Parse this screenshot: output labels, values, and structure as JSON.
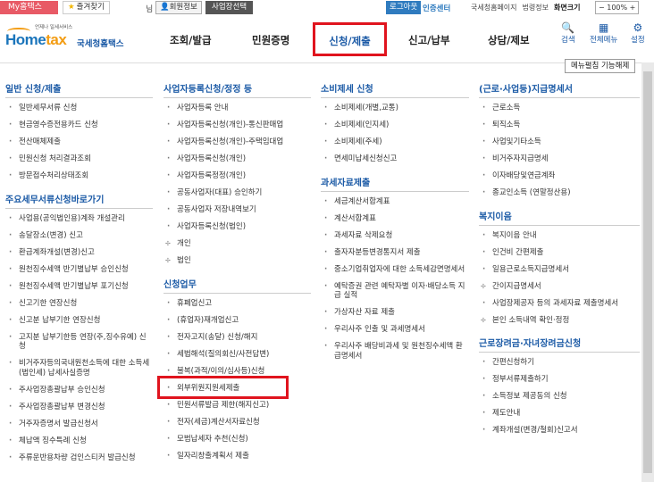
{
  "topbar": {
    "myhome": "My홈택스",
    "favorites": "즐겨찾기",
    "user_suffix": "님",
    "member_info": "회원정보",
    "biz_select": "사업장선택",
    "logout": "로그아웃",
    "cert_center": "인증센터",
    "links": [
      "국세청홈페이지",
      "법령정보"
    ],
    "screen_size": "화면크기",
    "zoom": "100%"
  },
  "logo": {
    "tagline": "언제나 일세서비스",
    "name_en_1": "Home",
    "name_en_2": "tax",
    "name_ko": "국세청홈택스"
  },
  "gnb": {
    "items": [
      "조회/발급",
      "민원증명",
      "신청/제출",
      "신고/납부",
      "상담/제보"
    ],
    "active": "신청/제출",
    "search": "검색",
    "all_menu": "전체메뉴",
    "settings": "설정"
  },
  "menu_fix": "메뉴펼침 기능해제",
  "col1": {
    "title": "일반 신청/제출",
    "items": [
      "일반세무서류 신청",
      "현금영수증전용카드 신청",
      "전산매체제출",
      "민원신청 처리결과조회",
      "방문접수처리상태조회"
    ],
    "title2": "주요세무서류신청바로가기",
    "items2": [
      "사업용(공익법인용)계좌 개설관리",
      "송달장소(변경) 신고",
      "환급계좌개설(변경)신고",
      "원천징수세액 반기별납부 승인신청",
      "원천징수세액 반기별납부 포기신청",
      "신고기한 연장신청",
      "신고분 납부기한 연장신청",
      "고지분 납부기한등 연장(주,징수유예) 신청",
      "비거주자등의국내원천소득에 대한 소득세(법인세) 납세사실증명",
      "주사업장총괄납부 승인신청",
      "주사업장총괄납부 변경신청",
      "거주자증명서 발급신청서",
      "체납액 징수특례 신청",
      "주류운반용차량 검인스티커 발급신청"
    ]
  },
  "col2": {
    "title": "사업자등록신청/정정 등",
    "items": [
      "사업자등록 안내",
      "사업자등록신청(개인)-통신판매업",
      "사업자등록신청(개인)-주택임대업",
      "사업자등록신청(개인)",
      "사업자등록정정(개인)",
      "공동사업자(대표) 승인하기",
      "공동사업자 저장내역보기",
      "사업자등록신청(법인)"
    ],
    "plus_items": [
      "개인",
      "법인"
    ],
    "title2": "신청업무",
    "items2": [
      "휴폐업신고",
      "(휴업자)재개업신고",
      "전자고지(송달) 신청/해지",
      "세법해석(질의회신/사전답변)",
      "불복(과적/이의/심사등)신청",
      "외부위원지원세제출",
      "민원서류발급 제한(해지신고)",
      "전자(세금)계산서자료신청",
      "모범납세자 추천(신청)",
      "일자리창출계획서 제출"
    ]
  },
  "col3": {
    "title": "소비제세 신청",
    "items": [
      "소비제세(개별,교통)",
      "소비제세(인지세)",
      "소비제세(주세)",
      "면세미납세신청신고"
    ],
    "title2": "과세자료제출",
    "items2": [
      "세금계산서합계표",
      "계산서합계표",
      "과세자료 삭제요청",
      "출자자분등변경통지서 제출",
      "중소기업취업자에 대한 소득세감면명세서",
      "예탁증권 관련 예탁자별 이자·배당소득 지급 실적",
      "가상자산 자료 제출",
      "우리사주 인출 및 과세명세서",
      "우리사주 배당비과세 및 원천징수세액 환급명세서"
    ]
  },
  "col4": {
    "title": "(근로·사업등)지급명세서",
    "items": [
      "근로소득",
      "퇴직소득",
      "사업및기타소득",
      "비거주자지급명세",
      "이자배당및연금계좌",
      "종교인소득 (연말정산용)"
    ],
    "title2": "복지이음",
    "items2": [
      "복지이음 안내",
      "인건비 간편제출",
      "일용근로소득지급명세서",
      "간이지급명세서",
      "사업장제공자 등의 과세자료 제출명세서",
      "본인 소득내역 확인·정정"
    ],
    "plus_items2": [
      "간이지급명세서",
      "본인 소득내역 확인·정정"
    ],
    "title3": "근로장려금·자녀장려금신청",
    "items3": [
      "간편신청하기",
      "정부서류제출하기",
      "소득정보 제공동의 신청",
      "제도안내",
      "계좌개설(변경/철회)신고서"
    ]
  }
}
